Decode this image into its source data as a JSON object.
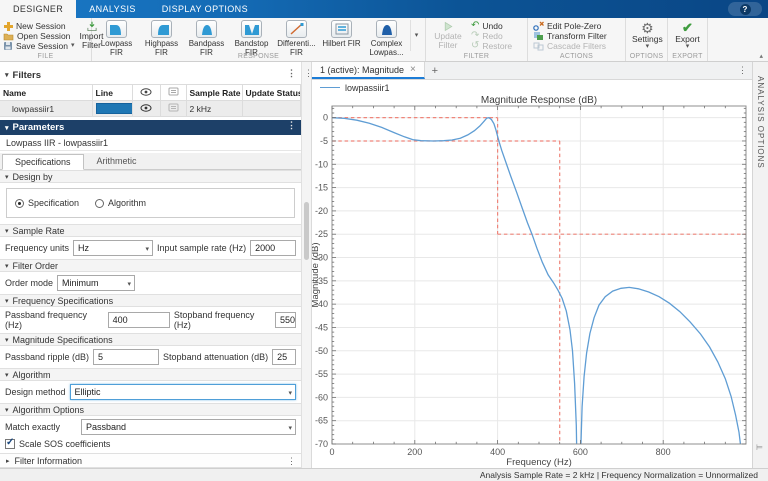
{
  "ribbon": {
    "tabs": [
      {
        "label": "DESIGNER",
        "active": true
      },
      {
        "label": "ANALYSIS",
        "active": false
      },
      {
        "label": "DISPLAY OPTIONS",
        "active": false
      }
    ],
    "help": "?",
    "file": {
      "caption": "FILE",
      "new_session": "New Session",
      "open_session": "Open Session",
      "save_session": "Save Session",
      "import_line1": "Import",
      "import_line2": "Filter"
    },
    "response": {
      "caption": "RESPONSE",
      "buttons": [
        {
          "line1": "Lowpass",
          "line2": "FIR"
        },
        {
          "line1": "Highpass",
          "line2": "FIR"
        },
        {
          "line1": "Bandpass",
          "line2": "FIR"
        },
        {
          "line1": "Bandstop",
          "line2": "FIR"
        },
        {
          "line1": "Differenti...",
          "line2": "FIR"
        },
        {
          "line1": "Hilbert FIR",
          "line2": ""
        },
        {
          "line1": "Complex",
          "line2": "Lowpas..."
        }
      ]
    },
    "filter": {
      "caption": "FILTER",
      "update_line1": "Update",
      "update_line2": "Filter",
      "undo": "Undo",
      "redo": "Redo",
      "restore": "Restore"
    },
    "actions": {
      "caption": "ACTIONS",
      "edit_pole_zero": "Edit Pole-Zero",
      "transform_filter": "Transform Filter",
      "cascade_filters": "Cascade Filters"
    },
    "options": {
      "caption": "OPTIONS",
      "settings": "Settings"
    },
    "export": {
      "caption": "EXPORT",
      "export": "Export"
    }
  },
  "filters_panel": {
    "title": "Filters",
    "columns": [
      "Name",
      "Line",
      "Sample Rate",
      "Update Status"
    ],
    "row": {
      "name": "lowpassiir1",
      "line_color": "#1f77b4",
      "sample_rate": "2 kHz",
      "update_status": ""
    }
  },
  "parameters": {
    "title": "Parameters",
    "subtitle": "Lowpass IIR - lowpassiir1",
    "tabs": [
      {
        "label": "Specifications",
        "active": true
      },
      {
        "label": "Arithmetic",
        "active": false
      }
    ],
    "design_by": {
      "header": "Design by",
      "options": [
        {
          "label": "Specification",
          "selected": true
        },
        {
          "label": "Algorithm",
          "selected": false
        }
      ]
    },
    "sample_rate": {
      "header": "Sample Rate",
      "freq_units_label": "Frequency units",
      "freq_units_value": "Hz",
      "input_rate_label": "Input sample rate (Hz)",
      "input_rate_value": "2000"
    },
    "filter_order": {
      "header": "Filter Order",
      "order_mode_label": "Order mode",
      "order_mode_value": "Minimum"
    },
    "frequency_specs": {
      "header": "Frequency Specifications",
      "passband_label": "Passband frequency (Hz)",
      "passband_value": "400",
      "stopband_label": "Stopband frequency (Hz)",
      "stopband_value": "550"
    },
    "magnitude_specs": {
      "header": "Magnitude Specifications",
      "ripple_label": "Passband ripple (dB)",
      "ripple_value": "5",
      "atten_label": "Stopband attenuation (dB)",
      "atten_value": "25"
    },
    "algorithm": {
      "header": "Algorithm",
      "design_method_label": "Design method",
      "design_method_value": "Elliptic"
    },
    "algorithm_options": {
      "header": "Algorithm Options",
      "match_label": "Match exactly",
      "match_value": "Passband",
      "scale_sos_label": "Scale SOS coefficients",
      "scale_sos_checked": true
    },
    "filter_information": {
      "header": "Filter Information"
    }
  },
  "figure": {
    "tab_label": "1 (active): Magnitude",
    "tab_close": "×",
    "new_tab": "+",
    "legend_label": "lowpassiir1"
  },
  "chart_data": {
    "type": "line",
    "title": "Magnitude Response (dB)",
    "xlabel": "Frequency (Hz)",
    "ylabel": "Magnitude (dB)",
    "xlim": [
      0,
      1000
    ],
    "ylim": [
      -70,
      2.5
    ],
    "xticks": [
      0,
      200,
      400,
      600,
      800
    ],
    "yticks": [
      0,
      -5,
      -10,
      -15,
      -20,
      -25,
      -30,
      -35,
      -40,
      -45,
      -50,
      -55,
      -60,
      -65,
      -70
    ],
    "x_minor_step": 50,
    "y_minor_step": 1,
    "grid": true,
    "legend_position": "top-left",
    "mask": {
      "label": "design-spec-mask",
      "color": "#ef857a",
      "style": "dashed",
      "segments": [
        [
          0,
          0,
          400,
          0
        ],
        [
          0,
          -5,
          550,
          -5
        ],
        [
          400,
          0,
          400,
          -25
        ],
        [
          400,
          -25,
          1000,
          -25
        ],
        [
          550,
          -5,
          550,
          -70
        ]
      ]
    },
    "series": [
      {
        "name": "lowpassiir1",
        "color": "#5f9dd4",
        "points": [
          [
            0,
            0
          ],
          [
            30,
            -0.15
          ],
          [
            60,
            -0.55
          ],
          [
            90,
            -1.2
          ],
          [
            120,
            -2.1
          ],
          [
            150,
            -3.2
          ],
          [
            175,
            -4.1
          ],
          [
            195,
            -4.7
          ],
          [
            215,
            -4.95
          ],
          [
            245,
            -5.0
          ],
          [
            270,
            -4.95
          ],
          [
            290,
            -4.8
          ],
          [
            310,
            -4.4
          ],
          [
            328,
            -3.7
          ],
          [
            344,
            -2.8
          ],
          [
            357,
            -1.8
          ],
          [
            367,
            -0.8
          ],
          [
            374,
            -0.1
          ],
          [
            379,
            0
          ],
          [
            385,
            -0.4
          ],
          [
            391,
            -1.3
          ],
          [
            396,
            -2.6
          ],
          [
            400,
            -4.0
          ],
          [
            404,
            -5.3
          ],
          [
            410,
            -7.0
          ],
          [
            420,
            -9.6
          ],
          [
            432,
            -12.6
          ],
          [
            446,
            -16.0
          ],
          [
            460,
            -19.5
          ],
          [
            472,
            -22.5
          ],
          [
            483,
            -25.0
          ],
          [
            495,
            -28.0
          ],
          [
            508,
            -31.0
          ],
          [
            522,
            -33.7
          ],
          [
            535,
            -35.4
          ],
          [
            546,
            -37.0
          ],
          [
            556,
            -38.8
          ],
          [
            566,
            -41.5
          ],
          [
            575,
            -45.5
          ],
          [
            581,
            -50.0
          ],
          [
            586,
            -57.0
          ],
          [
            590,
            -66.0
          ],
          [
            591,
            -71.0
          ],
          [
            601,
            -71.0
          ],
          [
            604,
            -62.0
          ],
          [
            609,
            -55.5
          ],
          [
            615,
            -50.5
          ],
          [
            623,
            -46.3
          ],
          [
            633,
            -42.9
          ],
          [
            645,
            -40.2
          ],
          [
            660,
            -38.4
          ],
          [
            678,
            -37.2
          ],
          [
            698,
            -36.6
          ],
          [
            718,
            -36.4
          ],
          [
            740,
            -36.7
          ],
          [
            765,
            -37.4
          ],
          [
            790,
            -38.4
          ],
          [
            815,
            -39.8
          ],
          [
            840,
            -41.6
          ],
          [
            865,
            -43.8
          ],
          [
            890,
            -46.4
          ],
          [
            912,
            -49.2
          ],
          [
            932,
            -52.4
          ],
          [
            950,
            -56.0
          ],
          [
            964,
            -59.8
          ],
          [
            975,
            -63.8
          ],
          [
            983,
            -67.5
          ],
          [
            988,
            -71.0
          ]
        ]
      }
    ]
  },
  "analysis_strip": {
    "label": "ANALYSIS OPTIONS"
  },
  "status_bar": {
    "text": "Analysis Sample Rate = 2 kHz | Frequency Normalization = Unnormalized"
  }
}
